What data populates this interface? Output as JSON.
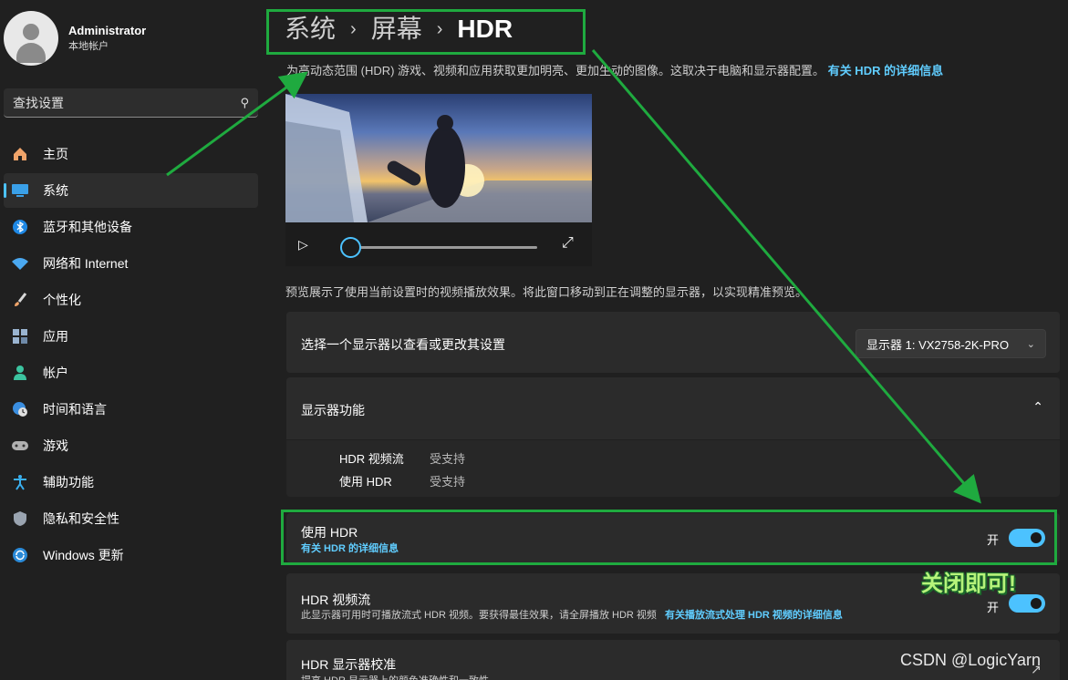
{
  "account": {
    "name": "Administrator",
    "type": "本地帐户"
  },
  "search": {
    "placeholder": "查找设置",
    "icon": "search-icon"
  },
  "sidebar": {
    "items": [
      {
        "label": "主页",
        "icon": "home-icon",
        "active": false
      },
      {
        "label": "系统",
        "icon": "monitor-icon",
        "active": true
      },
      {
        "label": "蓝牙和其他设备",
        "icon": "bluetooth-icon",
        "active": false
      },
      {
        "label": "网络和 Internet",
        "icon": "wifi-icon",
        "active": false
      },
      {
        "label": "个性化",
        "icon": "brush-icon",
        "active": false
      },
      {
        "label": "应用",
        "icon": "apps-icon",
        "active": false
      },
      {
        "label": "帐户",
        "icon": "person-icon",
        "active": false
      },
      {
        "label": "时间和语言",
        "icon": "globe-clock-icon",
        "active": false
      },
      {
        "label": "游戏",
        "icon": "gamepad-icon",
        "active": false
      },
      {
        "label": "辅助功能",
        "icon": "accessibility-icon",
        "active": false
      },
      {
        "label": "隐私和安全性",
        "icon": "shield-icon",
        "active": false
      },
      {
        "label": "Windows 更新",
        "icon": "update-icon",
        "active": false
      }
    ]
  },
  "breadcrumb": {
    "level1": "系统",
    "level2": "屏幕",
    "level3": "HDR"
  },
  "intro": {
    "text": "为高动态范围 (HDR) 游戏、视频和应用获取更加明亮、更加生动的图像。这取决于电脑和显示器配置。",
    "link": "有关 HDR 的详细信息"
  },
  "player": {
    "progress": 0
  },
  "preview_note": "预览展示了使用当前设置时的视频播放效果。将此窗口移动到正在调整的显示器，以实现精准预览。",
  "display_select": {
    "label": "选择一个显示器以查看或更改其设置",
    "value": "显示器 1: VX2758-2K-PRO"
  },
  "capabilities": {
    "title": "显示器功能",
    "rows": [
      {
        "name": "HDR 视频流",
        "value": "受支持"
      },
      {
        "name": "使用 HDR",
        "value": "受支持"
      }
    ]
  },
  "use_hdr": {
    "title": "使用 HDR",
    "link": "有关 HDR 的详细信息",
    "state_label": "开",
    "on": true
  },
  "hdr_stream": {
    "title": "HDR 视频流",
    "desc": "此显示器可用时可播放流式 HDR 视频。要获得最佳效果，请全屏播放 HDR 视频",
    "link": "有关播放流式处理 HDR 视频的详细信息",
    "state_label": "开",
    "on": true
  },
  "calibration": {
    "title": "HDR 显示器校准",
    "desc": "提高 HDR 显示器上的颜色准确性和一致性"
  },
  "annotation": {
    "text": "关闭即可!"
  },
  "watermark": "CSDN @LogicYarn",
  "colors": {
    "accent": "#4cc2ff",
    "link": "#60cdff",
    "highlight": "#1faa3f",
    "annotation": "#b6f37a"
  }
}
